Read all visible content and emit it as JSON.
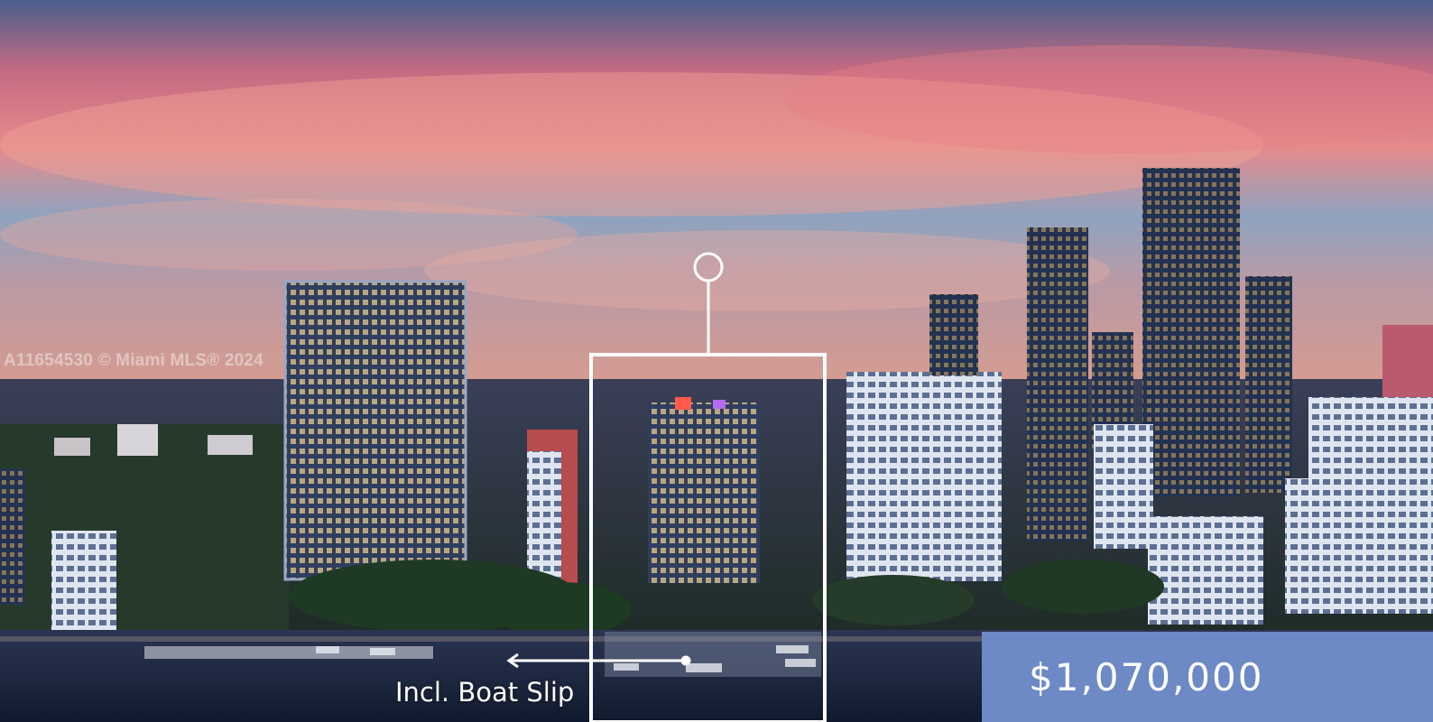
{
  "listing": {
    "watermark": "A11654530 © Miami MLS® 2024",
    "callout_label": "Incl. Boat Slip",
    "price": "$1,070,000",
    "colors": {
      "price_box": "#6d89c6",
      "highlight_frame": "#ffffff",
      "sky_top": "#3e5a86",
      "sky_glow": "#e8878c",
      "water": "#16233c"
    }
  }
}
